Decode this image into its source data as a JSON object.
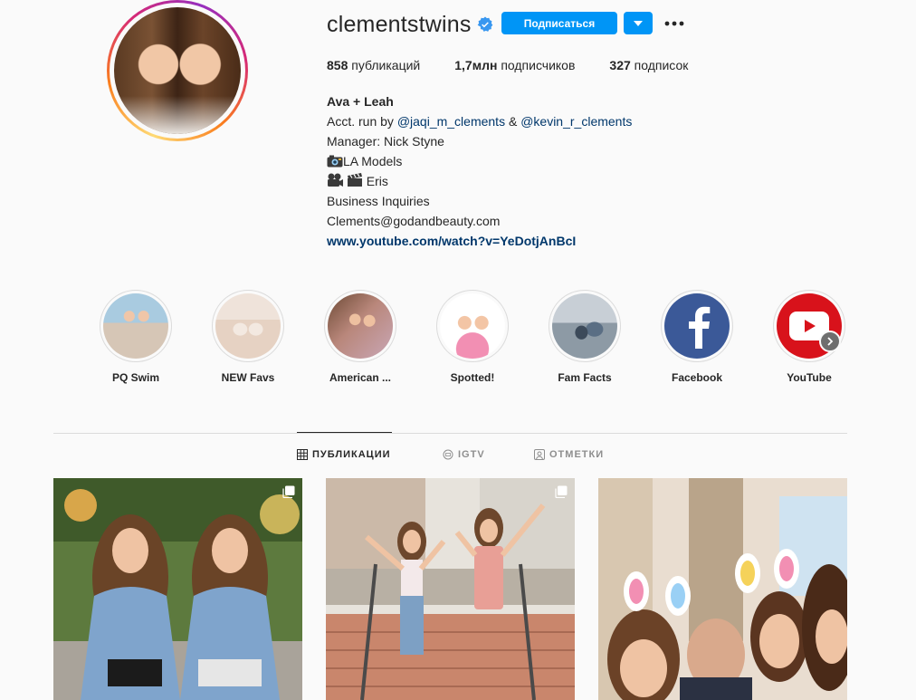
{
  "profile": {
    "username": "clementstwins",
    "follow_label": "Подписаться",
    "stats": {
      "posts_count": "858",
      "posts_label": "публикаций",
      "followers_count": "1,7млн",
      "followers_label": "подписчиков",
      "following_count": "327",
      "following_label": "подписок"
    },
    "bio": {
      "name": "Ava + Leah",
      "acct_prefix": "Acct. run by",
      "mention1": "@jaqi_m_clements",
      "amp": "&",
      "mention2": "@kevin_r_clements",
      "manager": "Manager: Nick Styne",
      "la_models": "LA Models",
      "eris": "Eris",
      "business": "Business Inquiries",
      "email": "Clements@godandbeauty.com",
      "link": "www.youtube.com/watch?v=YeDotjAnBcI"
    }
  },
  "highlights": [
    {
      "label": "PQ Swim"
    },
    {
      "label": "NEW Favs"
    },
    {
      "label": "American ..."
    },
    {
      "label": "Spotted!"
    },
    {
      "label": "Fam Facts"
    },
    {
      "label": "Facebook"
    },
    {
      "label": "YouTube"
    }
  ],
  "tabs": {
    "posts": "ПУБЛИКАЦИИ",
    "igtv": "IGTV",
    "tagged": "ОТМЕТКИ"
  },
  "colors": {
    "accent": "#0095f6",
    "link": "#00376b",
    "background": "#fafafa",
    "facebook": "#3b5998",
    "youtube": "#d8121b"
  },
  "icons": {
    "verified": "verified-badge-icon",
    "dropdown": "chevron-down-icon",
    "more": "more-dots-icon",
    "grid": "grid-icon",
    "igtv": "igtv-icon",
    "tagged": "tagged-icon",
    "next": "chevron-right-icon",
    "multi": "multiple-posts-icon"
  }
}
